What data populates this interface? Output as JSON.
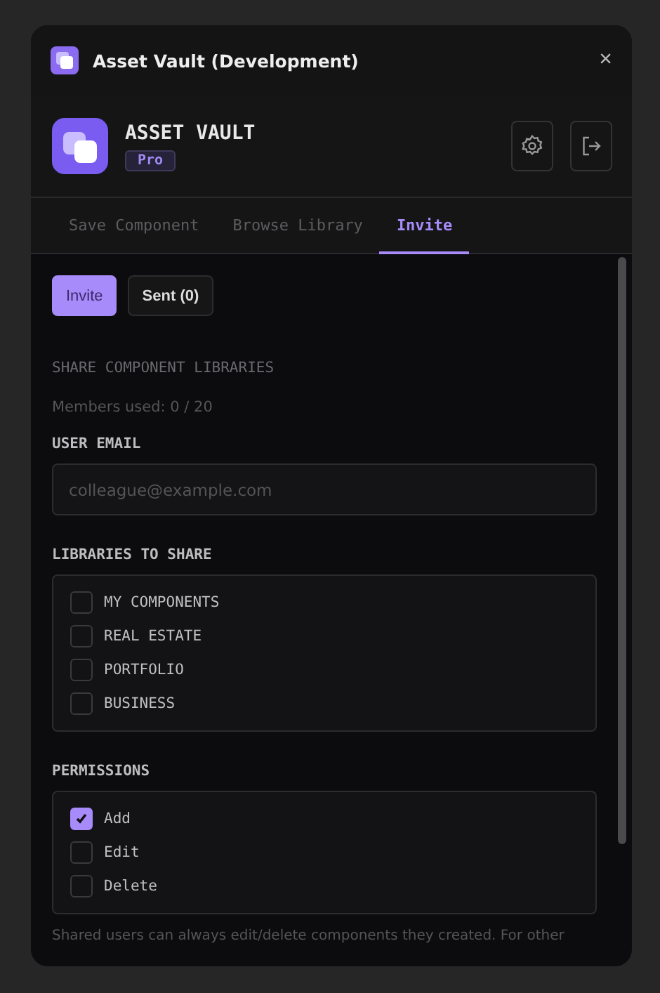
{
  "window": {
    "title": "Asset Vault (Development)",
    "close": "×"
  },
  "header": {
    "name": "ASSET VAULT",
    "plan": "Pro"
  },
  "tabs": [
    {
      "label": "Save Component",
      "selected": false
    },
    {
      "label": "Browse Library",
      "selected": false
    },
    {
      "label": "Invite",
      "selected": true
    }
  ],
  "subtabs": [
    {
      "label": "Invite",
      "selected": true
    },
    {
      "label": "Sent (0)",
      "selected": false
    }
  ],
  "section_title": "SHARE COMPONENT LIBRARIES",
  "members_used": "Members used: 0 / 20",
  "email": {
    "label": "USER EMAIL",
    "placeholder": "colleague@example.com"
  },
  "libraries": {
    "label": "LIBRARIES TO SHARE",
    "items": [
      {
        "label": "MY COMPONENTS",
        "checked": false
      },
      {
        "label": "REAL ESTATE",
        "checked": false
      },
      {
        "label": "PORTFOLIO",
        "checked": false
      },
      {
        "label": "BUSINESS",
        "checked": false
      }
    ]
  },
  "permissions": {
    "label": "PERMISSIONS",
    "items": [
      {
        "label": "Add",
        "checked": true
      },
      {
        "label": "Edit",
        "checked": false
      },
      {
        "label": "Delete",
        "checked": false
      }
    ]
  },
  "note": "Shared users can always edit/delete components they created. For other"
}
